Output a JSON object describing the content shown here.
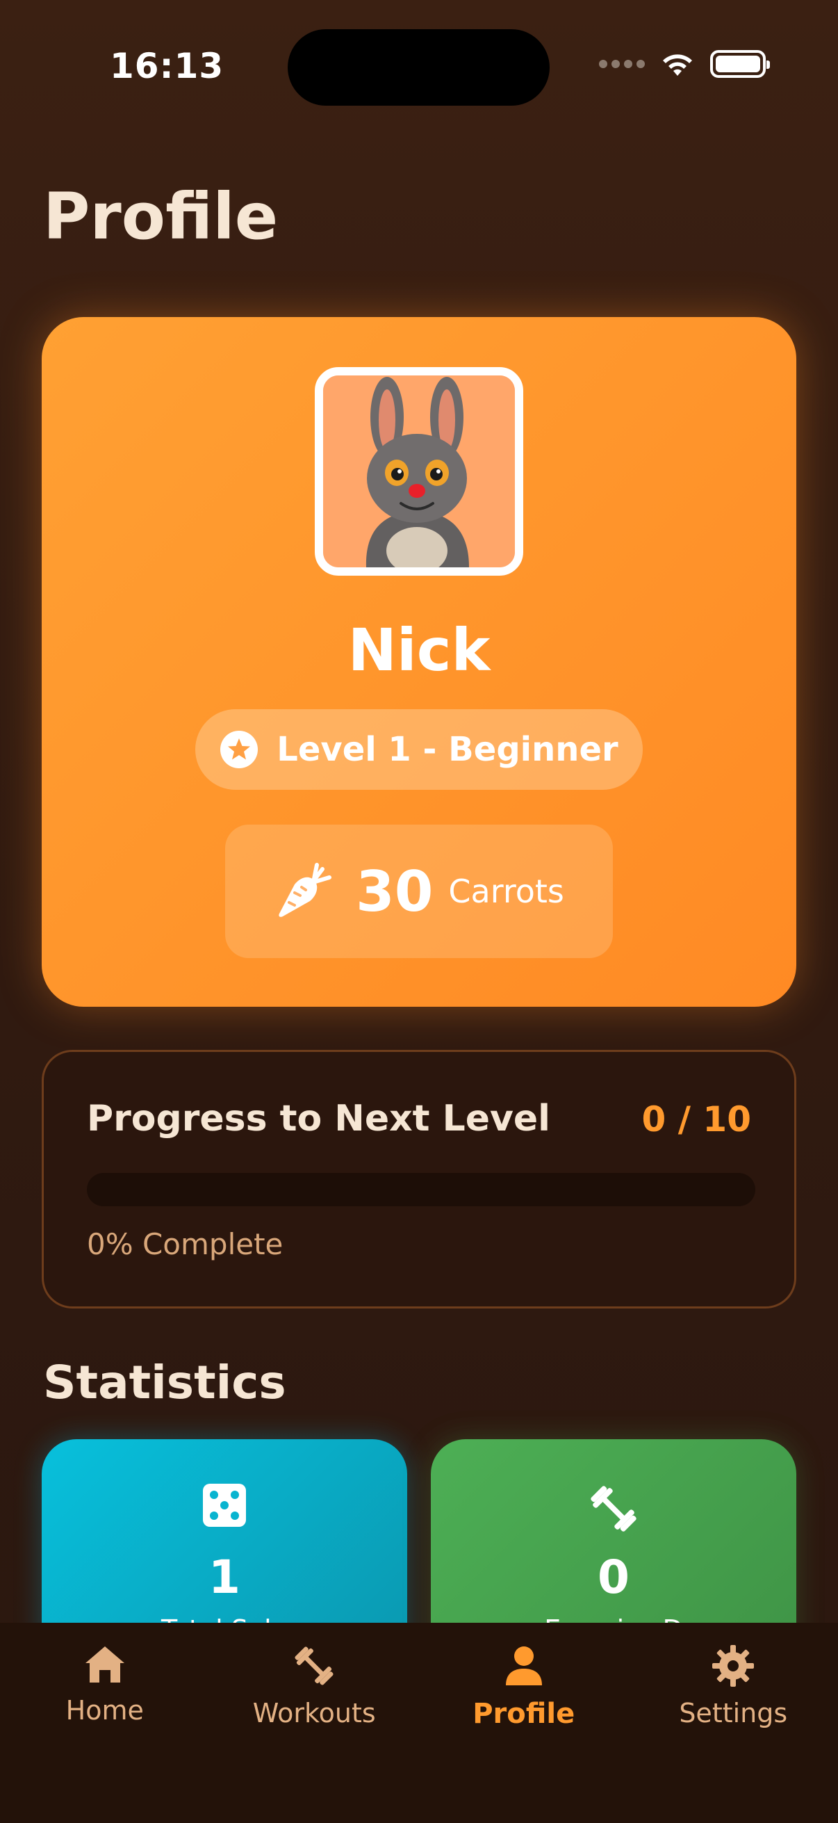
{
  "status_bar": {
    "time": "16:13"
  },
  "header": {
    "title": "Profile"
  },
  "profile": {
    "name": "Nick",
    "level_label": "Level 1 - Beginner",
    "carrots_count": "30",
    "carrots_label": "Carrots"
  },
  "progress": {
    "title": "Progress to Next Level",
    "count": "0 / 10",
    "percent_text": "0% Complete",
    "fraction": 0
  },
  "statistics": {
    "title": "Statistics",
    "cards": [
      {
        "value": "1",
        "label": "Total Solo",
        "icon": "dice-icon",
        "color": "#08c0dc"
      },
      {
        "value": "0",
        "label": "Exercise D",
        "icon": "dumbbell-icon",
        "color": "#4daf55"
      }
    ]
  },
  "tab_bar": {
    "items": [
      {
        "label": "Home",
        "icon": "home-icon"
      },
      {
        "label": "Workouts",
        "icon": "dumbbell-icon"
      },
      {
        "label": "Profile",
        "icon": "person-icon",
        "active": true
      },
      {
        "label": "Settings",
        "icon": "gear-icon"
      }
    ]
  },
  "colors": {
    "background": "#3a1f12",
    "accent": "#ff9a2e",
    "profile_card": "#ff9a2e",
    "tab_bar": "#231209"
  }
}
